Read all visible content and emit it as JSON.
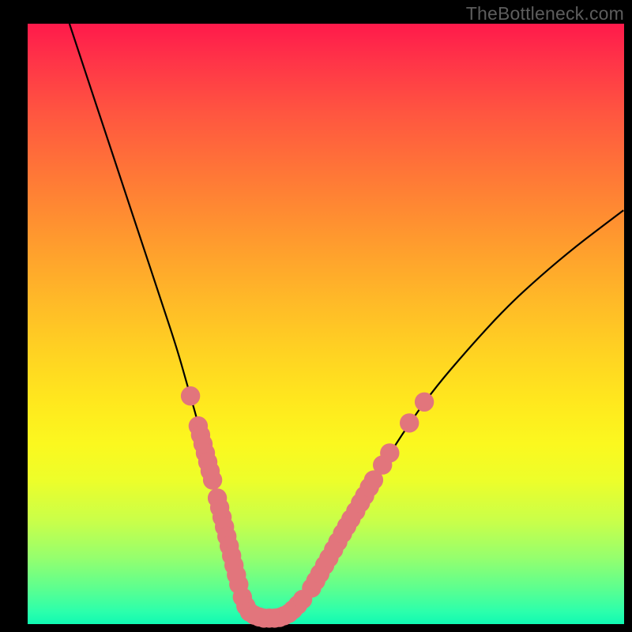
{
  "watermark": "TheBottleneck.com",
  "chart_data": {
    "type": "line",
    "title": "",
    "xlabel": "",
    "ylabel": "",
    "xlim": [
      0,
      100
    ],
    "ylim": [
      0,
      100
    ],
    "grid": false,
    "series": [
      {
        "name": "curve",
        "x": [
          7,
          10,
          13,
          16,
          19,
          22,
          25,
          27,
          29,
          31,
          32.5,
          34,
          35,
          36,
          37,
          38,
          40,
          42,
          44,
          47,
          50,
          54,
          58,
          63,
          68,
          74,
          80,
          86,
          92,
          98,
          100
        ],
        "y": [
          100,
          91,
          82,
          73,
          64,
          55,
          46,
          39,
          32,
          24,
          18,
          12,
          8,
          5,
          2.5,
          1.5,
          1,
          1,
          2,
          5,
          10,
          17,
          24,
          32,
          39,
          46,
          52.5,
          58,
          63,
          67.5,
          69
        ],
        "color": "#000000"
      }
    ],
    "markers": [
      {
        "x": 27.3,
        "y": 38.0,
        "r": 1.2
      },
      {
        "x": 28.6,
        "y": 33.0,
        "r": 1.2
      },
      {
        "x": 29.0,
        "y": 31.5,
        "r": 1.2
      },
      {
        "x": 29.4,
        "y": 30.0,
        "r": 1.2
      },
      {
        "x": 29.8,
        "y": 28.5,
        "r": 1.2
      },
      {
        "x": 30.2,
        "y": 27.0,
        "r": 1.2
      },
      {
        "x": 30.6,
        "y": 25.5,
        "r": 1.2
      },
      {
        "x": 31.0,
        "y": 24.0,
        "r": 1.2
      },
      {
        "x": 31.8,
        "y": 21.0,
        "r": 1.2
      },
      {
        "x": 32.2,
        "y": 19.4,
        "r": 1.2
      },
      {
        "x": 32.6,
        "y": 17.8,
        "r": 1.2
      },
      {
        "x": 33.0,
        "y": 16.2,
        "r": 1.2
      },
      {
        "x": 33.4,
        "y": 14.6,
        "r": 1.2
      },
      {
        "x": 33.8,
        "y": 13.0,
        "r": 1.2
      },
      {
        "x": 34.2,
        "y": 11.4,
        "r": 1.2
      },
      {
        "x": 34.6,
        "y": 9.8,
        "r": 1.2
      },
      {
        "x": 35.0,
        "y": 8.2,
        "r": 1.2
      },
      {
        "x": 35.4,
        "y": 6.6,
        "r": 1.2
      },
      {
        "x": 36.0,
        "y": 4.5,
        "r": 1.2
      },
      {
        "x": 36.6,
        "y": 3.0,
        "r": 1.2
      },
      {
        "x": 37.2,
        "y": 2.0,
        "r": 1.2
      },
      {
        "x": 38.0,
        "y": 1.5,
        "r": 1.2
      },
      {
        "x": 38.8,
        "y": 1.2,
        "r": 1.2
      },
      {
        "x": 39.6,
        "y": 1.0,
        "r": 1.2
      },
      {
        "x": 40.5,
        "y": 1.0,
        "r": 1.2
      },
      {
        "x": 41.4,
        "y": 1.0,
        "r": 1.2
      },
      {
        "x": 42.2,
        "y": 1.1,
        "r": 1.2
      },
      {
        "x": 43.0,
        "y": 1.4,
        "r": 1.2
      },
      {
        "x": 43.8,
        "y": 1.8,
        "r": 1.2
      },
      {
        "x": 44.5,
        "y": 2.4,
        "r": 1.2
      },
      {
        "x": 45.3,
        "y": 3.2,
        "r": 1.2
      },
      {
        "x": 46.1,
        "y": 4.1,
        "r": 1.2
      },
      {
        "x": 47.6,
        "y": 6.0,
        "r": 1.2
      },
      {
        "x": 48.3,
        "y": 7.2,
        "r": 1.2
      },
      {
        "x": 49.0,
        "y": 8.4,
        "r": 1.2
      },
      {
        "x": 49.8,
        "y": 9.8,
        "r": 1.2
      },
      {
        "x": 50.5,
        "y": 11.0,
        "r": 1.2
      },
      {
        "x": 51.3,
        "y": 12.4,
        "r": 1.2
      },
      {
        "x": 52.0,
        "y": 13.7,
        "r": 1.2
      },
      {
        "x": 52.8,
        "y": 15.1,
        "r": 1.2
      },
      {
        "x": 53.5,
        "y": 16.3,
        "r": 1.2
      },
      {
        "x": 54.2,
        "y": 17.5,
        "r": 1.2
      },
      {
        "x": 55.0,
        "y": 18.8,
        "r": 1.2
      },
      {
        "x": 55.8,
        "y": 20.2,
        "r": 1.2
      },
      {
        "x": 56.5,
        "y": 21.4,
        "r": 1.2
      },
      {
        "x": 57.3,
        "y": 22.8,
        "r": 1.2
      },
      {
        "x": 58.0,
        "y": 24.0,
        "r": 1.2
      },
      {
        "x": 59.5,
        "y": 26.5,
        "r": 1.2
      },
      {
        "x": 60.7,
        "y": 28.5,
        "r": 1.2
      },
      {
        "x": 64.0,
        "y": 33.5,
        "r": 1.2
      },
      {
        "x": 66.5,
        "y": 37.0,
        "r": 1.2
      }
    ],
    "marker_color": "#e2757c"
  }
}
